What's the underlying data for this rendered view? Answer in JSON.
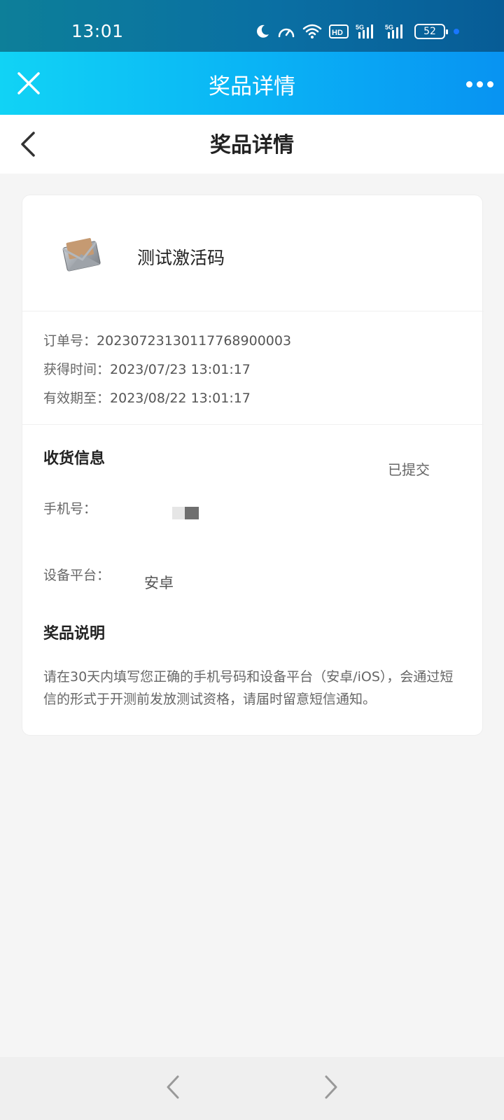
{
  "status_bar": {
    "time": "13:01",
    "battery_level": "52",
    "icons": [
      "moon-icon",
      "speedometer-icon",
      "wifi-icon",
      "hd-icon",
      "5g-signal-icon",
      "5g-signal-icon",
      "battery-icon"
    ]
  },
  "app_header": {
    "title": "奖品详情",
    "close_icon": "close-icon",
    "more_icon": "more-icon"
  },
  "nav": {
    "title": "奖品详情",
    "back_icon": "chevron-left-icon"
  },
  "prize": {
    "name": "测试激活码",
    "thumbnail_icon": "envelope-icon"
  },
  "order": {
    "order_no_label": "订单号：",
    "order_no": "20230723130117768900003",
    "obtained_label": "获得时间：",
    "obtained_time": "2023/07/23 13:01:17",
    "expires_label": "有效期至：",
    "expires_time": "2023/08/22 13:01:17"
  },
  "shipping": {
    "title": "收货信息",
    "status": "已提交",
    "phone_label": "手机号：",
    "platform_label": "设备平台：",
    "platform_value": "安卓"
  },
  "description": {
    "title": "奖品说明",
    "text": "请在30天内填写您正确的手机号码和设备平台（安卓/iOS），会通过短信的形式于开测前发放测试资格，请届时留意短信通知。"
  },
  "bottom_nav": {
    "back_icon": "chevron-left-icon",
    "forward_icon": "chevron-right-icon"
  },
  "colors": {
    "header_gradient_start": "#11d3f5",
    "header_gradient_end": "#0893f2",
    "status_bar": "#0a6fa3",
    "page_bg": "#f5f5f5"
  }
}
